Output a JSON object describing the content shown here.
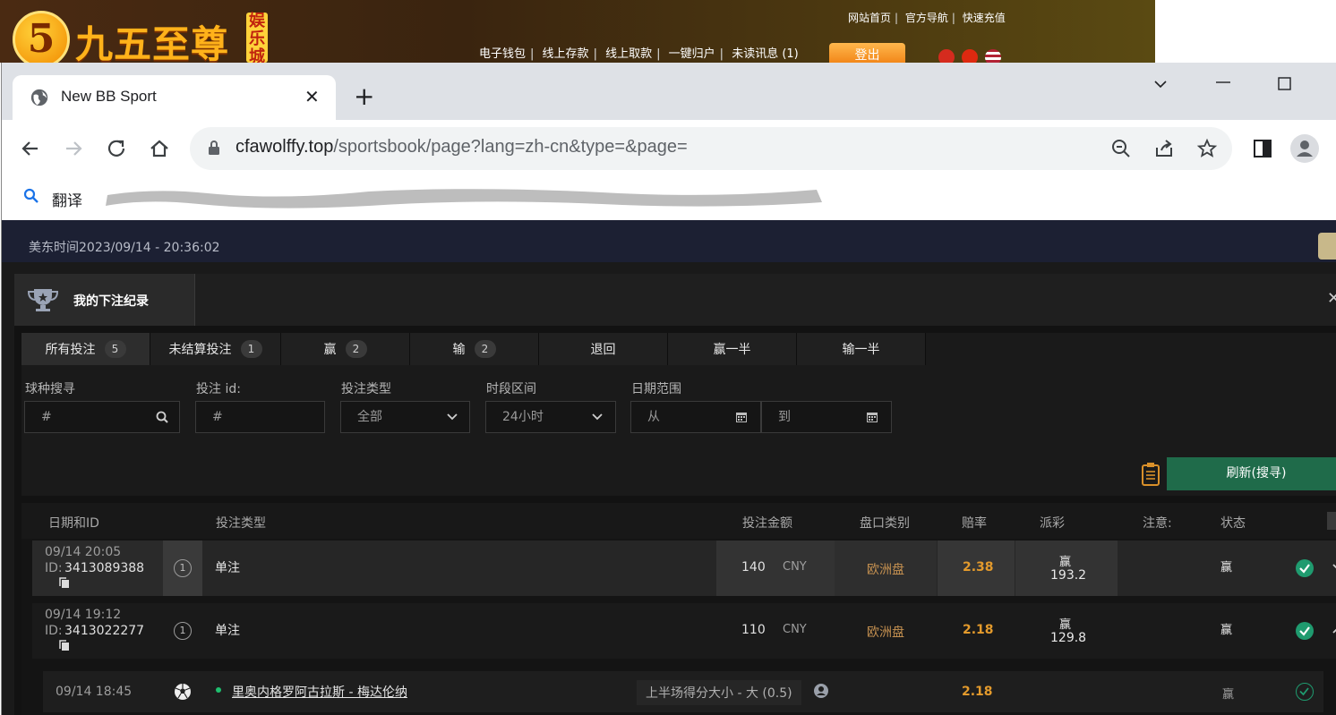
{
  "site": {
    "logo_char": "5",
    "logo_text": "九五至尊",
    "logo_badge": "娱乐城",
    "top_links": [
      "网站首页",
      "官方导航",
      "快速充值"
    ],
    "main_links": [
      "电子钱包",
      "线上存款",
      "线上取款",
      "一键归户",
      "未读讯息 (1)"
    ],
    "logout": "登出"
  },
  "browser": {
    "tab_title": "New BB Sport",
    "url_domain": "cfawolffy.top",
    "url_path": "/sportsbook/page?lang=zh-cn&type=&page=",
    "bookmark_translate": "翻译"
  },
  "timebar": {
    "text": "美东时间2023/09/14 - 20:36:02"
  },
  "panel": {
    "title": "我的下注纪录"
  },
  "filters": {
    "tabs": [
      {
        "label": "所有投注",
        "count": "5"
      },
      {
        "label": "未结算投注",
        "count": "1"
      },
      {
        "label": "赢",
        "count": "2"
      },
      {
        "label": "输",
        "count": "2"
      },
      {
        "label": "退回",
        "count": ""
      },
      {
        "label": "赢一半",
        "count": ""
      },
      {
        "label": "输一半",
        "count": ""
      }
    ],
    "sport_label": "球种搜寻",
    "sport_placeholder": "#",
    "betid_label": "投注 id:",
    "betid_placeholder": "#",
    "bettype_label": "投注类型",
    "bettype_value": "全部",
    "period_label": "时段区间",
    "period_value": "24小时",
    "daterange_label": "日期范围",
    "from_placeholder": "从",
    "to_placeholder": "到",
    "refresh": "刷新(搜寻)"
  },
  "table": {
    "headers": [
      "日期和ID",
      "投注类型",
      "投注金额",
      "盘口类别",
      "赔率",
      "派彩",
      "注意:",
      "状态"
    ],
    "rows": [
      {
        "date": "09/14 20:05",
        "id_prefix": "ID:",
        "id": "3413089388",
        "legs": "1",
        "type": "单注",
        "amount": "140",
        "currency": "CNY",
        "market": "欧洲盘",
        "odds": "2.38",
        "payout_status": "赢",
        "payout": "193.2",
        "status": "赢"
      },
      {
        "date": "09/14 19:12",
        "id_prefix": "ID:",
        "id": "3413022277",
        "legs": "1",
        "type": "单注",
        "amount": "110",
        "currency": "CNY",
        "market": "欧洲盘",
        "odds": "2.18",
        "payout_status": "赢",
        "payout": "129.8",
        "status": "赢"
      }
    ],
    "sub_row": {
      "date": "09/14 18:45",
      "match": "里奥内格罗阿古拉斯 - 梅达伦纳",
      "selection": "上半场得分大小 - 大 (0.5)",
      "odds": "2.18",
      "status": "赢"
    }
  }
}
